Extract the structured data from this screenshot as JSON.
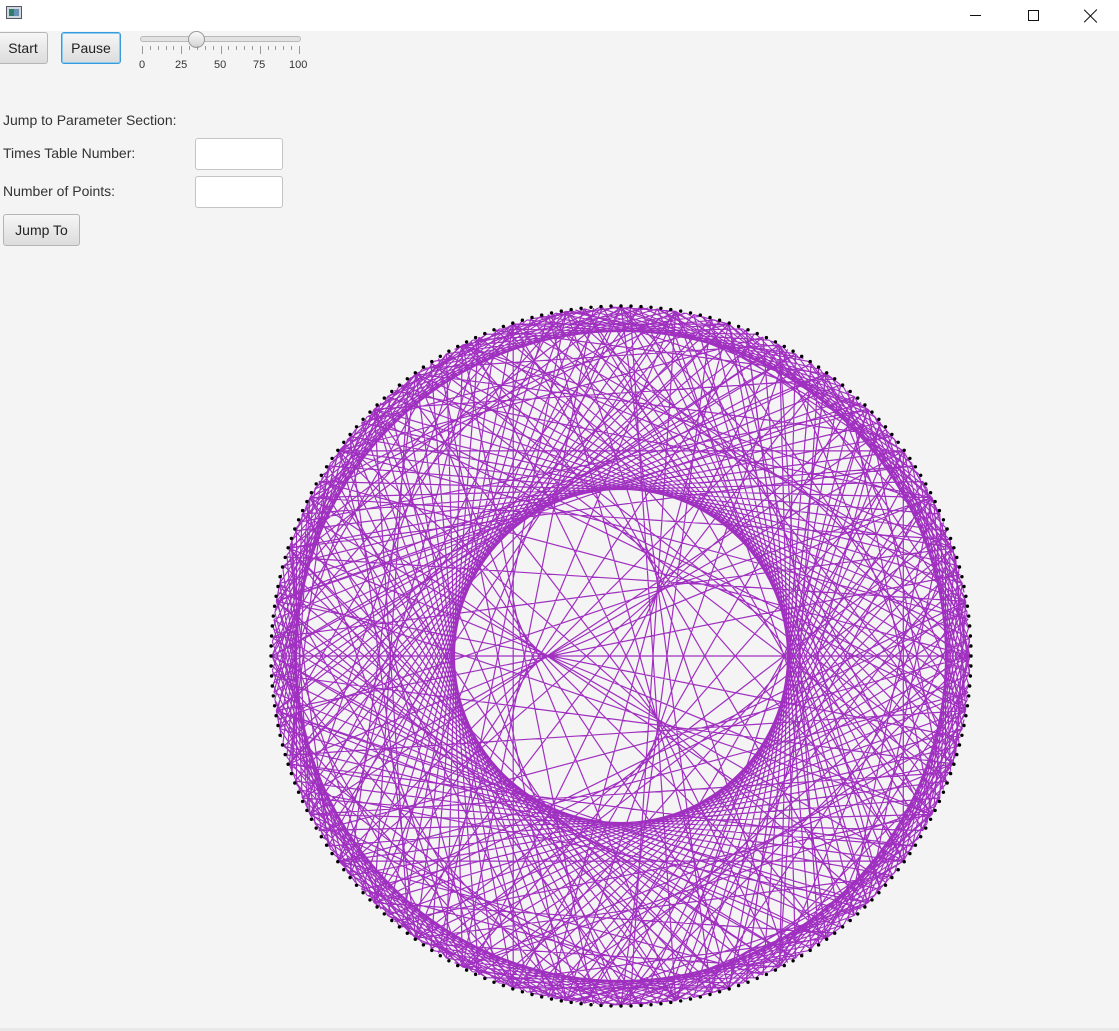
{
  "window": {
    "title": "",
    "controls": [
      "minimize",
      "maximize",
      "close"
    ]
  },
  "toolbar": {
    "start_label": "Start",
    "pause_label": "Pause",
    "speed_slider": {
      "min": 0,
      "max": 100,
      "value": 35,
      "tick_labels": [
        "0",
        "25",
        "50",
        "75",
        "100"
      ]
    }
  },
  "jump_section": {
    "heading": "Jump to Parameter Section:",
    "times_table_label": "Times Table Number:",
    "times_table_value": "",
    "points_label": "Number of Points:",
    "points_value": "",
    "jump_button_label": "Jump To"
  },
  "visualization": {
    "line_color": "#a030c0",
    "point_color": "#000000",
    "background": "#f4f4f4"
  }
}
